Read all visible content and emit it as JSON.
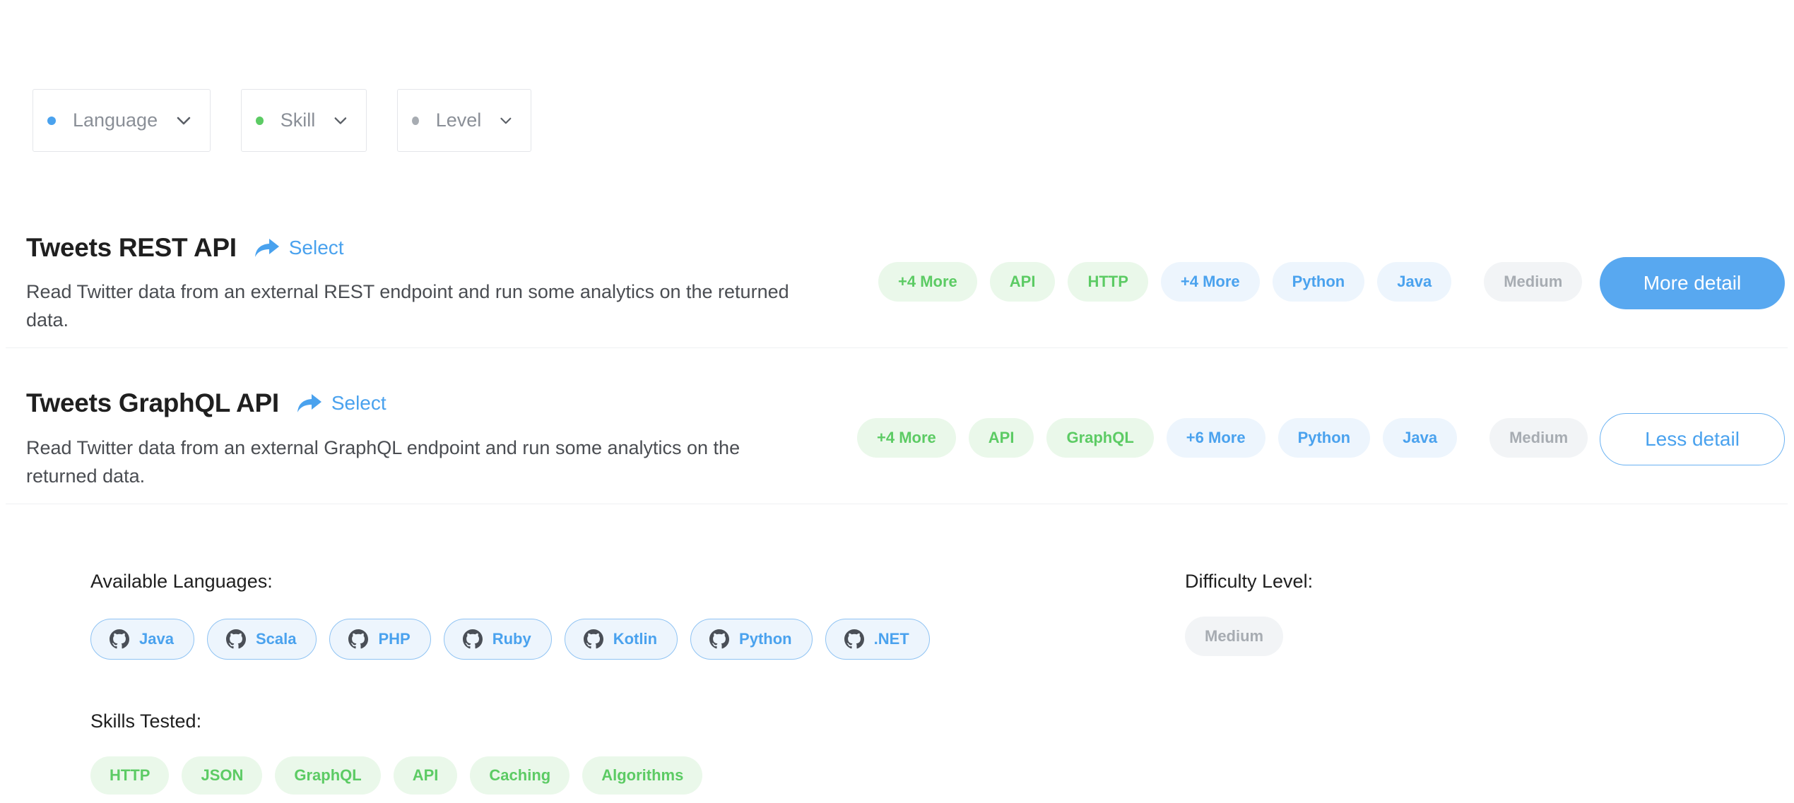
{
  "filters": [
    {
      "label": "Language",
      "dot_color": "#4aa2ee"
    },
    {
      "label": "Skill",
      "dot_color": "#5ccb64"
    },
    {
      "label": "Level",
      "dot_color": "#a7acb2"
    }
  ],
  "challenges": [
    {
      "title": "Tweets REST API",
      "select_label": "Select",
      "description": "Read Twitter data from an external REST endpoint and run some analytics on the returned data.",
      "skill_tags": [
        "+4 More",
        "API",
        "HTTP"
      ],
      "language_tags": [
        "+4 More",
        "Python",
        "Java"
      ],
      "level": "Medium",
      "action_label": "More detail"
    },
    {
      "title": "Tweets GraphQL API",
      "select_label": "Select",
      "description": "Read Twitter data from an external GraphQL endpoint and run some analytics on the returned data.",
      "skill_tags": [
        "+4 More",
        "API",
        "GraphQL"
      ],
      "language_tags": [
        "+6 More",
        "Python",
        "Java"
      ],
      "level": "Medium",
      "action_label": "Less detail"
    }
  ],
  "details": {
    "languages_label": "Available Languages:",
    "languages": [
      "Java",
      "Scala",
      "PHP",
      "Ruby",
      "Kotlin",
      "Python",
      ".NET"
    ],
    "difficulty_label": "Difficulty Level:",
    "difficulty": "Medium",
    "skills_label": "Skills Tested:",
    "skills": [
      "HTTP",
      "JSON",
      "GraphQL",
      "API",
      "Caching",
      "Algorithms"
    ]
  },
  "colors": {
    "accent_blue": "#4aa2ee",
    "accent_green": "#5ccb64",
    "muted_gray": "#a7acb2"
  }
}
